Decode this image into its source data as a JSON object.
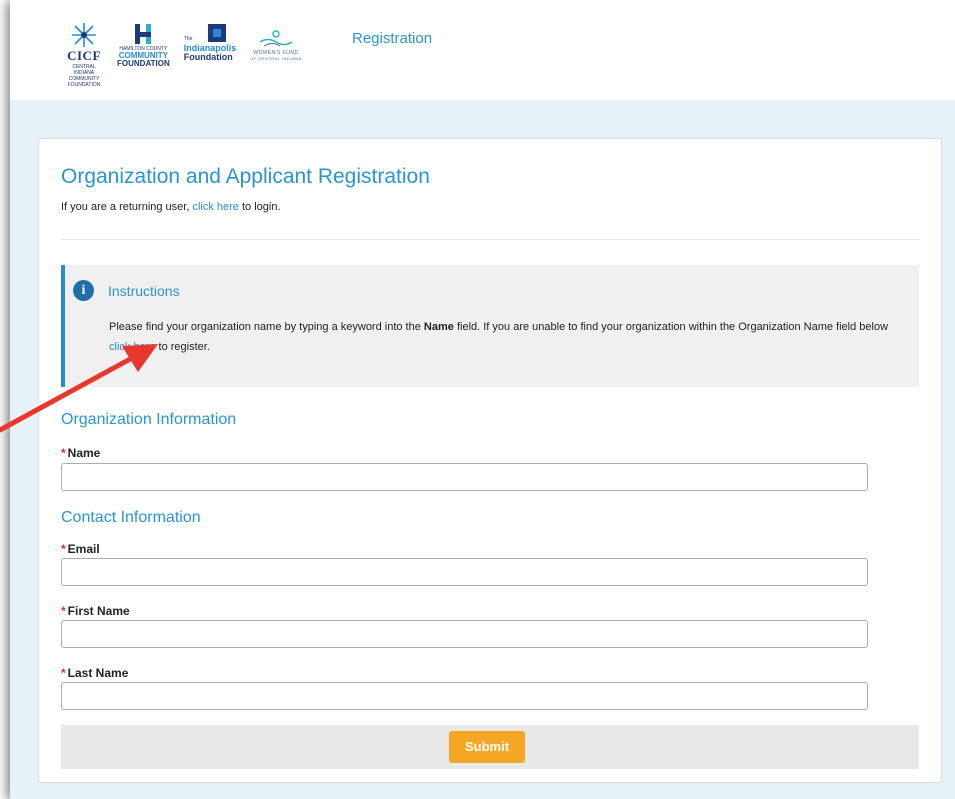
{
  "header": {
    "nav_title": "Registration",
    "logos": [
      {
        "name": "CICF",
        "sub": "CENTRAL INDIANA COMMUNITY FOUNDATION"
      },
      {
        "name": "HAMILTON COUNTY",
        "line2": "COMMUNITY",
        "line3": "FOUNDATION"
      },
      {
        "name": "The",
        "line2": "Indianapolis",
        "line3": "Foundation"
      },
      {
        "name": "WOMEN'S FUND",
        "line2": "OF CENTRAL INDIANA"
      }
    ]
  },
  "page": {
    "title": "Organization and Applicant Registration",
    "returning_prefix": "If you are a returning user, ",
    "returning_link": "click here",
    "returning_suffix": " to login."
  },
  "instructions": {
    "title": "Instructions",
    "body_part1": "Please find your organization name by typing a keyword into the ",
    "body_bold": "Name",
    "body_part2": " field. If you are unable to find your organization within the Organization Name field below ",
    "body_link": "click here",
    "body_part3": " to register."
  },
  "sections": {
    "organization": "Organization Information",
    "contact": "Contact Information"
  },
  "fields": {
    "required_mark": "*",
    "name": {
      "label": "Name",
      "value": ""
    },
    "email": {
      "label": "Email",
      "value": ""
    },
    "first_name": {
      "label": "First Name",
      "value": ""
    },
    "last_name": {
      "label": "Last Name",
      "value": ""
    }
  },
  "submit_label": "Submit",
  "colors": {
    "accent": "#2a96cf",
    "required": "#d9342b",
    "submit": "#f5a623",
    "annotation_arrow": "#e8382e"
  }
}
